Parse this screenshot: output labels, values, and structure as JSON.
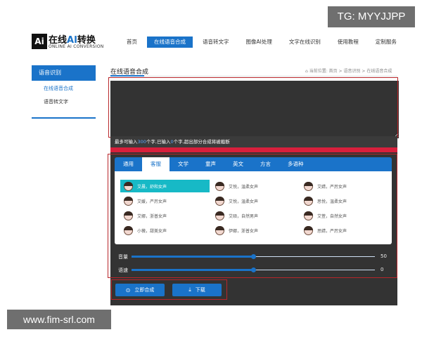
{
  "overlay": {
    "tg": "TG: MYYJJPP",
    "watermark": "www.fim-srl.com"
  },
  "logo": {
    "box": "Ai",
    "cn_prefix": "在线",
    "cn_ai": "AI",
    "cn_suffix": "转换",
    "en": "ONLINE AI CONVERSION"
  },
  "nav": [
    "首页",
    "在线语音合成",
    "语音转文字",
    "图像AI处理",
    "文字在线识别",
    "使用教程",
    "定制服务"
  ],
  "sidebar": {
    "head": "语音识别",
    "items": [
      "在线语音合成",
      "语音转文字"
    ]
  },
  "main": {
    "title": "在线语音合成",
    "breadcrumb": "当前位置: 首页 > 语音识别 > 在线语音合成"
  },
  "hint": {
    "prefix": "最多可输入",
    "max": "300",
    "mid": "个字,已输入",
    "count": "0",
    "suffix": "个字,超出部分合成将被截断"
  },
  "tabs": [
    "通用",
    "客服",
    "文学",
    "童声",
    "英文",
    "方言",
    "多语种"
  ],
  "voices": [
    [
      "艾晨，舒和女声",
      "艾悦，温柔女声",
      "艾婧，严厉女声"
    ],
    [
      "艾媛，严厉女声",
      "艾悦，温柔女声",
      "思悦，温柔女声"
    ],
    [
      "艾娜，浙普女声",
      "艾硕，自然男声",
      "艾萱，自然女声"
    ],
    [
      "小薇，甜美女声",
      "伊娜，浙普女声",
      "思婧，严厉女声"
    ]
  ],
  "sliders": {
    "volume_label": "音量",
    "volume_value": "50",
    "speed_label": "语速",
    "speed_value": "0"
  },
  "buttons": {
    "synth": "立即合成",
    "download": "下载"
  },
  "colors": {
    "accent": "#1a73c9",
    "selected": "#17b9c6",
    "highlight": "#b8262a"
  }
}
